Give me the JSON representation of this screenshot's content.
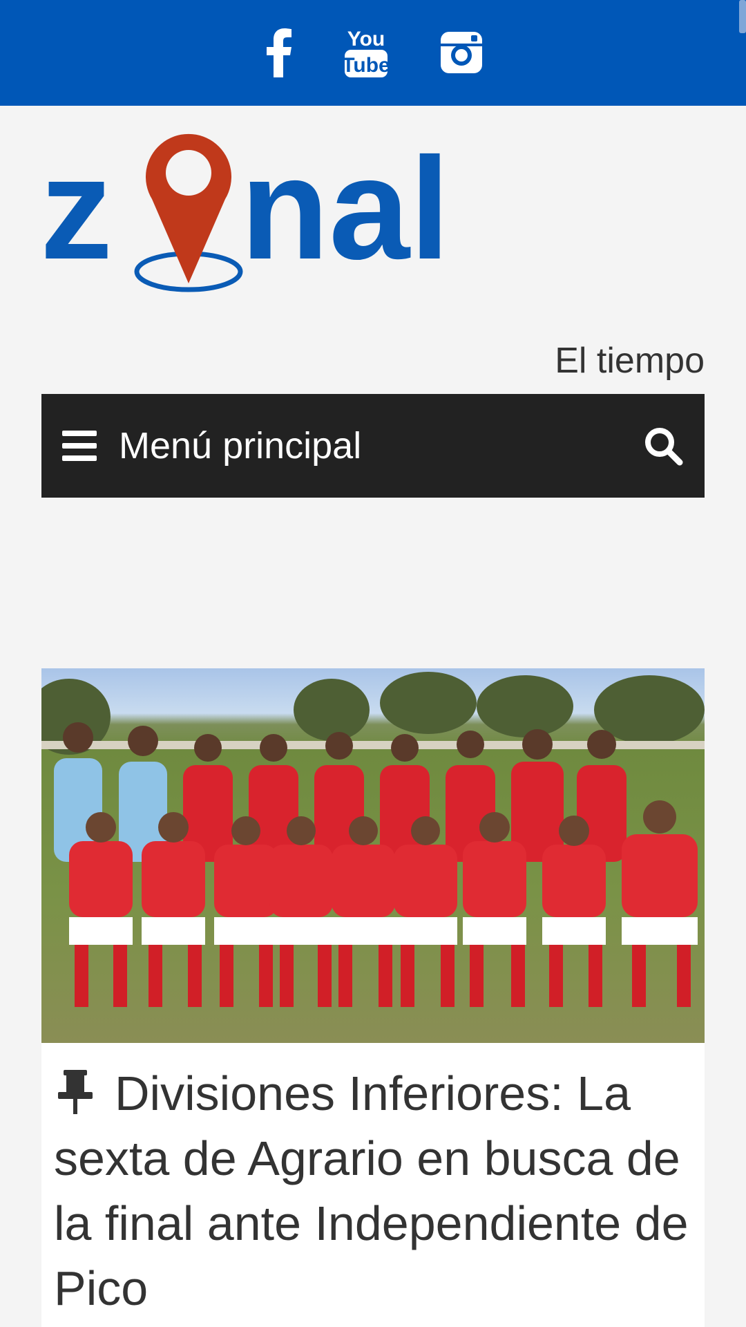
{
  "topbar": {
    "background": "#0057b7",
    "social": [
      {
        "icon": "facebook-icon"
      },
      {
        "icon": "youtube-icon",
        "text_top": "You",
        "text_bottom": "Tube"
      },
      {
        "icon": "instagram-icon"
      }
    ]
  },
  "logo": {
    "text_z": "z",
    "text_nal": "nal",
    "blue": "#0a5bb5",
    "orange": "#c0391b"
  },
  "header": {
    "weather_link": "El tiempo"
  },
  "nav": {
    "menu_label": "Menú principal",
    "icon_menu": "hamburger-icon",
    "icon_search": "search-icon",
    "background": "#222222"
  },
  "article": {
    "image_alt": "Equipo de la sexta división de Agrario posando en la cancha",
    "pin_icon": "pushpin-icon",
    "headline": "Divisiones Inferiores: La sexta de Agrario en busca de la final ante Independiente de Pico"
  }
}
